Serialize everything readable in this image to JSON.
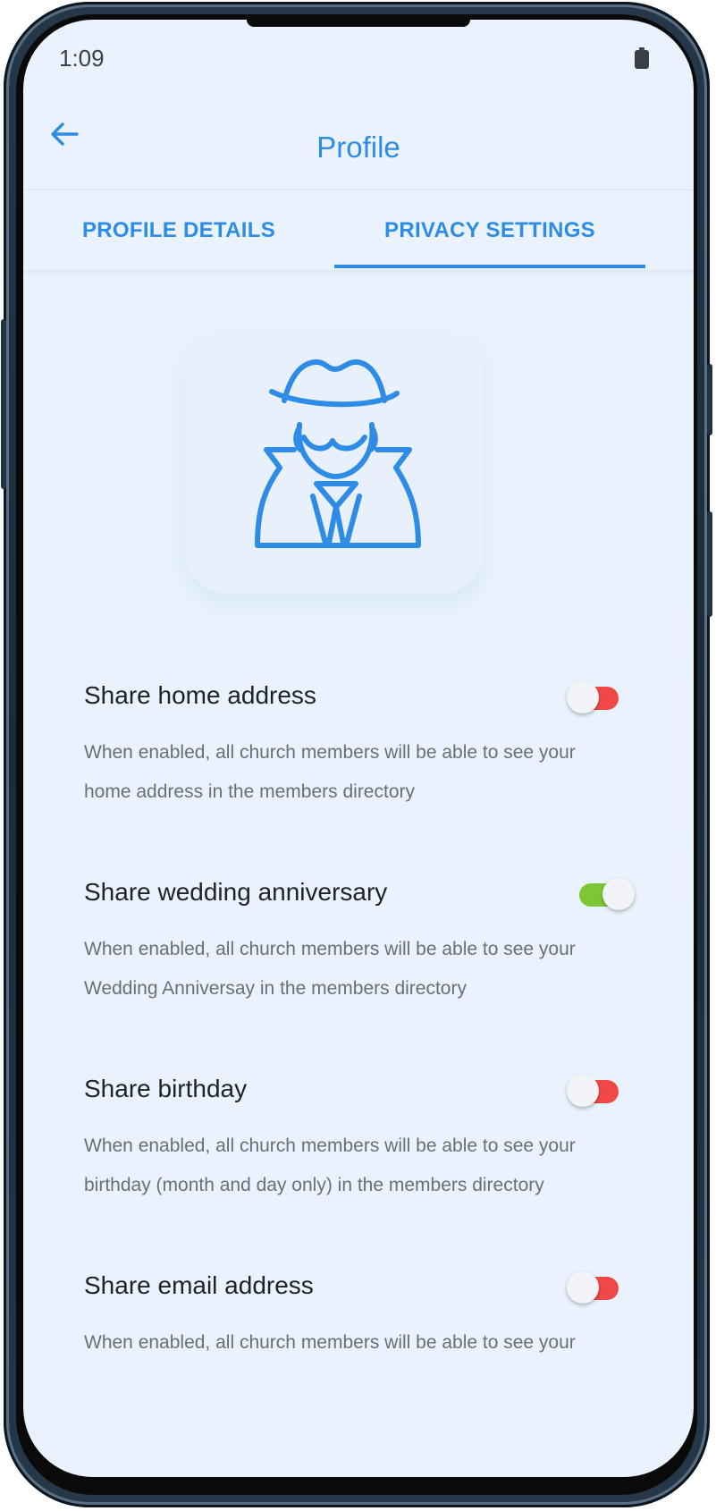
{
  "status_bar": {
    "time": "1:09"
  },
  "header": {
    "title": "Profile",
    "back_icon": "arrow-left-icon"
  },
  "tabs": [
    {
      "label": "PROFILE DETAILS",
      "selected": false
    },
    {
      "label": "PRIVACY SETTINGS",
      "selected": true
    }
  ],
  "hero": {
    "icon": "incognito-spy-icon"
  },
  "settings": [
    {
      "title": "Share home address",
      "description": "When enabled, all church members will be able to see your home address in the members directory",
      "enabled": false
    },
    {
      "title": "Share wedding anniversary",
      "description": "When enabled, all church members will be able to see your Wedding Anniversay in the members directory",
      "enabled": true
    },
    {
      "title": "Share birthday",
      "description": "When enabled, all church members will be able to see your birthday (month and day only) in the members directory",
      "enabled": false
    },
    {
      "title": "Share email address",
      "description": "When enabled, all church members will be able to see your",
      "enabled": false
    }
  ],
  "colors": {
    "accent": "#2f8ce6",
    "toggle_off": "#f04747",
    "toggle_on": "#7dc734",
    "background": "#eaf3fd"
  }
}
